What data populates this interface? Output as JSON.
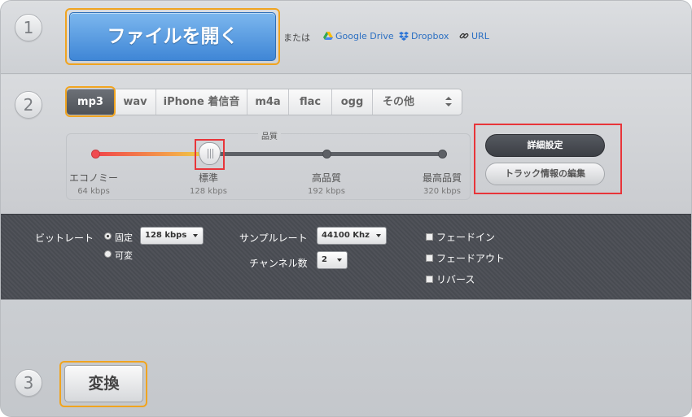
{
  "steps": [
    "1",
    "2",
    "3"
  ],
  "open": {
    "button_label": "ファイルを開く",
    "or_text": "または",
    "sources": [
      {
        "label": "Google Drive",
        "icon": "google-drive-icon"
      },
      {
        "label": "Dropbox",
        "icon": "dropbox-icon"
      },
      {
        "label": "URL",
        "icon": "link-icon"
      }
    ]
  },
  "formats": {
    "tabs": [
      "mp3",
      "wav",
      "iPhone 着信音",
      "m4a",
      "flac",
      "ogg"
    ],
    "active": "mp3",
    "other_select": "その他"
  },
  "quality": {
    "title": "品質",
    "selected_index": 1,
    "levels": [
      {
        "name": "エコノミー",
        "bitrate": "64 kbps"
      },
      {
        "name": "標準",
        "bitrate": "128 kbps"
      },
      {
        "name": "高品質",
        "bitrate": "192 kbps"
      },
      {
        "name": "最高品質",
        "bitrate": "320 kbps"
      }
    ]
  },
  "buttons": {
    "advanced": "詳細設定",
    "track_info": "トラック情報の編集"
  },
  "advanced": {
    "bitrate_label": "ビットレート",
    "bitrate_modes": [
      "固定",
      "可変"
    ],
    "bitrate_mode_selected": "固定",
    "bitrate_value": "128 kbps",
    "sample_rate_label": "サンプルレート",
    "sample_rate_value": "44100 Khz",
    "channels_label": "チャンネル数",
    "channels_value": "2",
    "options": [
      "フェードイン",
      "フェードアウト",
      "リバース"
    ]
  },
  "convert": {
    "label": "変換"
  },
  "colors": {
    "open_button": "#4a90dc",
    "highlight_orange": "#f0a420",
    "highlight_red": "#e8353a",
    "link": "#2b6fc2",
    "advanced_panel": "#4a4d54"
  }
}
